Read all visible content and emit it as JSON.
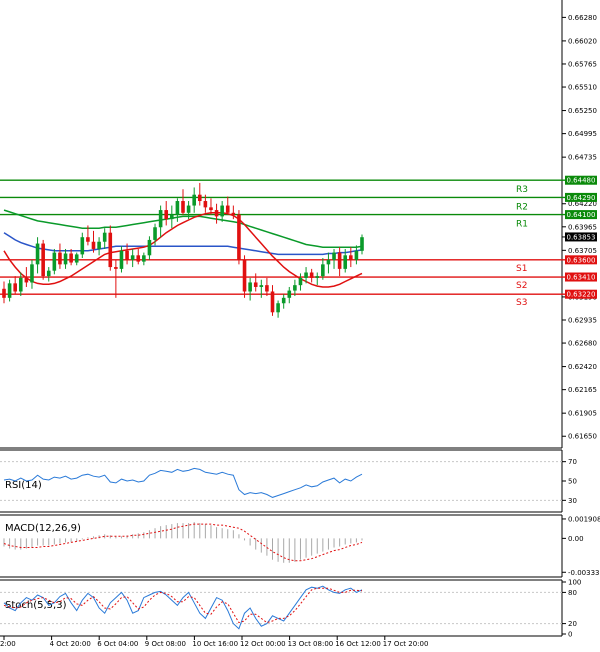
{
  "chart_data": {
    "type": "candlestick",
    "price_axis": {
      "ylim": [
        0.6152,
        0.6645
      ],
      "ticks": [
        "0.66280",
        "0.66020",
        "0.65765",
        "0.65510",
        "0.65250",
        "0.64995",
        "0.64735",
        "0.64220",
        "0.63965",
        "0.63705",
        "0.63190",
        "0.62935",
        "0.62680",
        "0.62420",
        "0.62165",
        "0.61905",
        "0.61650"
      ],
      "current_price": "0.63853"
    },
    "time_axis": {
      "labels": [
        "2:00",
        "4 Oct 20:00",
        "6 Oct 04:00",
        "9 Oct 08:00",
        "10 Oct 16:00",
        "12 Oct 00:00",
        "13 Oct 08:00",
        "16 Oct 12:00",
        "17 Oct 20:00"
      ]
    },
    "resistance": [
      {
        "name": "R3",
        "price": 0.6448,
        "label": "0.64480"
      },
      {
        "name": "R2",
        "price": 0.6429,
        "label": "0.64290"
      },
      {
        "name": "R1",
        "price": 0.641,
        "label": "0.64100"
      }
    ],
    "support": [
      {
        "name": "S1",
        "price": 0.636,
        "label": "0.63600"
      },
      {
        "name": "S2",
        "price": 0.6341,
        "label": "0.63410"
      },
      {
        "name": "S3",
        "price": 0.6322,
        "label": "0.63220"
      }
    ],
    "candles": [
      [
        0.6328,
        0.6336,
        0.6312,
        0.6318
      ],
      [
        0.6318,
        0.6338,
        0.6314,
        0.6334
      ],
      [
        0.6334,
        0.6342,
        0.6322,
        0.6325
      ],
      [
        0.6325,
        0.6346,
        0.632,
        0.634
      ],
      [
        0.634,
        0.6352,
        0.633,
        0.6335
      ],
      [
        0.6335,
        0.636,
        0.6328,
        0.6355
      ],
      [
        0.6355,
        0.6385,
        0.6345,
        0.6378
      ],
      [
        0.6378,
        0.6382,
        0.6338,
        0.6342
      ],
      [
        0.6342,
        0.6352,
        0.6336,
        0.6348
      ],
      [
        0.6348,
        0.6372,
        0.6344,
        0.6368
      ],
      [
        0.6368,
        0.6378,
        0.635,
        0.6355
      ],
      [
        0.6355,
        0.6372,
        0.635,
        0.6367
      ],
      [
        0.6367,
        0.6372,
        0.6354,
        0.6357
      ],
      [
        0.6357,
        0.6368,
        0.6354,
        0.6366
      ],
      [
        0.6366,
        0.639,
        0.6362,
        0.6385
      ],
      [
        0.6385,
        0.6398,
        0.6376,
        0.638
      ],
      [
        0.638,
        0.6392,
        0.6368,
        0.6372
      ],
      [
        0.6372,
        0.6385,
        0.6365,
        0.638
      ],
      [
        0.638,
        0.6395,
        0.6372,
        0.639
      ],
      [
        0.639,
        0.6398,
        0.6348,
        0.6352
      ],
      [
        0.6352,
        0.636,
        0.6318,
        0.635
      ],
      [
        0.635,
        0.6375,
        0.6346,
        0.637
      ],
      [
        0.637,
        0.6378,
        0.6355,
        0.636
      ],
      [
        0.636,
        0.6372,
        0.6352,
        0.6365
      ],
      [
        0.6365,
        0.6372,
        0.6355,
        0.6358
      ],
      [
        0.6358,
        0.6368,
        0.6354,
        0.6365
      ],
      [
        0.6365,
        0.6386,
        0.636,
        0.6382
      ],
      [
        0.6382,
        0.64,
        0.6376,
        0.6396
      ],
      [
        0.6396,
        0.642,
        0.6385,
        0.6415
      ],
      [
        0.6415,
        0.6425,
        0.6398,
        0.6405
      ],
      [
        0.6405,
        0.642,
        0.6395,
        0.641
      ],
      [
        0.641,
        0.6428,
        0.6402,
        0.6425
      ],
      [
        0.6425,
        0.6438,
        0.641,
        0.6412
      ],
      [
        0.6412,
        0.6425,
        0.6405,
        0.642
      ],
      [
        0.642,
        0.644,
        0.6412,
        0.6432
      ],
      [
        0.6432,
        0.6445,
        0.642,
        0.6425
      ],
      [
        0.6425,
        0.6432,
        0.6412,
        0.6418
      ],
      [
        0.6418,
        0.6428,
        0.641,
        0.6415
      ],
      [
        0.6415,
        0.6422,
        0.64,
        0.6408
      ],
      [
        0.6408,
        0.6425,
        0.6402,
        0.642
      ],
      [
        0.642,
        0.643,
        0.641,
        0.6412
      ],
      [
        0.6412,
        0.642,
        0.6405,
        0.641
      ],
      [
        0.641,
        0.6415,
        0.6355,
        0.636
      ],
      [
        0.636,
        0.6365,
        0.6318,
        0.6325
      ],
      [
        0.6325,
        0.634,
        0.6315,
        0.6335
      ],
      [
        0.6335,
        0.6345,
        0.6325,
        0.633
      ],
      [
        0.633,
        0.6338,
        0.6318,
        0.6332
      ],
      [
        0.6332,
        0.634,
        0.632,
        0.6325
      ],
      [
        0.6325,
        0.6332,
        0.6298,
        0.6302
      ],
      [
        0.6302,
        0.6315,
        0.6296,
        0.6312
      ],
      [
        0.6312,
        0.6322,
        0.6306,
        0.6318
      ],
      [
        0.6318,
        0.633,
        0.6312,
        0.6326
      ],
      [
        0.6326,
        0.6338,
        0.632,
        0.6332
      ],
      [
        0.6332,
        0.6345,
        0.6326,
        0.634
      ],
      [
        0.634,
        0.6352,
        0.6334,
        0.6346
      ],
      [
        0.6346,
        0.635,
        0.6335,
        0.634
      ],
      [
        0.634,
        0.6346,
        0.6332,
        0.6342
      ],
      [
        0.6342,
        0.6362,
        0.6338,
        0.6355
      ],
      [
        0.6355,
        0.6368,
        0.6345,
        0.636
      ],
      [
        0.636,
        0.6372,
        0.635,
        0.6368
      ],
      [
        0.6368,
        0.6374,
        0.6342,
        0.635
      ],
      [
        0.635,
        0.6372,
        0.6346,
        0.6365
      ],
      [
        0.6365,
        0.6374,
        0.6352,
        0.636
      ],
      [
        0.636,
        0.6376,
        0.6355,
        0.637
      ],
      [
        0.637,
        0.6388,
        0.6366,
        0.6385
      ]
    ],
    "moving_averages": [
      {
        "color": "#0a9a2a",
        "values": [
          0.6415,
          0.6413,
          0.6411,
          0.6409,
          0.6407,
          0.6405,
          0.6403,
          0.6402,
          0.6401,
          0.64,
          0.6399,
          0.6398,
          0.6397,
          0.6396,
          0.6395,
          0.6395,
          0.6395,
          0.6395,
          0.6396,
          0.6396,
          0.6396,
          0.6397,
          0.6398,
          0.6399,
          0.64,
          0.6401,
          0.6402,
          0.6403,
          0.6404,
          0.6405,
          0.6406,
          0.6407,
          0.6408,
          0.6408,
          0.6408,
          0.6408,
          0.6407,
          0.6406,
          0.6405,
          0.6404,
          0.6403,
          0.6402,
          0.6401,
          0.6399,
          0.6397,
          0.6395,
          0.6393,
          0.6391,
          0.6389,
          0.6387,
          0.6385,
          0.6383,
          0.6381,
          0.6379,
          0.6377,
          0.6376,
          0.6375,
          0.6374,
          0.6374,
          0.6374,
          0.6374,
          0.6374,
          0.6374,
          0.6374,
          0.6375
        ]
      },
      {
        "color": "#2a55c8",
        "values": [
          0.639,
          0.6386,
          0.6382,
          0.6379,
          0.6377,
          0.6375,
          0.6373,
          0.6372,
          0.6371,
          0.637,
          0.637,
          0.637,
          0.637,
          0.637,
          0.637,
          0.637,
          0.6371,
          0.6372,
          0.6373,
          0.6374,
          0.6375,
          0.6375,
          0.6375,
          0.6375,
          0.6375,
          0.6375,
          0.6375,
          0.6375,
          0.6375,
          0.6375,
          0.6375,
          0.6375,
          0.6375,
          0.6375,
          0.6375,
          0.6375,
          0.6375,
          0.6375,
          0.6375,
          0.6375,
          0.6375,
          0.6374,
          0.6373,
          0.6372,
          0.6371,
          0.637,
          0.6369,
          0.6368,
          0.6367,
          0.6366,
          0.6366,
          0.6366,
          0.6366,
          0.6366,
          0.6366,
          0.6366,
          0.6366,
          0.6366,
          0.6367,
          0.6367,
          0.6368,
          0.6368,
          0.6369,
          0.637,
          0.6371
        ]
      },
      {
        "color": "#e01010",
        "values": [
          0.637,
          0.636,
          0.6352,
          0.6345,
          0.634,
          0.6336,
          0.6334,
          0.6333,
          0.6333,
          0.6334,
          0.6336,
          0.6339,
          0.6342,
          0.6346,
          0.635,
          0.6354,
          0.6358,
          0.6362,
          0.6366,
          0.6368,
          0.6369,
          0.637,
          0.6371,
          0.6372,
          0.6373,
          0.6374,
          0.6376,
          0.638,
          0.6385,
          0.639,
          0.6394,
          0.6398,
          0.6401,
          0.6404,
          0.6407,
          0.6409,
          0.6411,
          0.6412,
          0.6412,
          0.6412,
          0.6411,
          0.6409,
          0.6405,
          0.6399,
          0.6392,
          0.6385,
          0.6378,
          0.6371,
          0.6364,
          0.6358,
          0.6352,
          0.6347,
          0.6343,
          0.6339,
          0.6336,
          0.6333,
          0.6331,
          0.633,
          0.633,
          0.6331,
          0.6333,
          0.6336,
          0.6339,
          0.6342,
          0.6345
        ]
      }
    ],
    "rsi": {
      "title": "RSI(14)",
      "ylim": [
        20,
        80
      ],
      "ticks": [
        "70",
        "50",
        "30"
      ],
      "values": [
        51,
        52,
        50,
        53,
        50,
        51,
        56,
        52,
        51,
        54,
        53,
        55,
        52,
        53,
        56,
        57,
        55,
        54,
        56,
        49,
        48,
        52,
        50,
        51,
        49,
        50,
        56,
        58,
        61,
        60,
        59,
        62,
        60,
        61,
        63,
        62,
        59,
        58,
        57,
        59,
        57,
        56,
        41,
        36,
        38,
        37,
        38,
        36,
        33,
        35,
        37,
        39,
        41,
        43,
        46,
        44,
        45,
        49,
        51,
        53,
        48,
        52,
        50,
        54,
        57
      ]
    },
    "macd": {
      "title": "MACD(12,26,9)",
      "ylim": [
        -0.0036,
        0.0021
      ],
      "ticks": [
        "0.001908",
        "0.00",
        "-0.003331"
      ],
      "hist": [
        -0.0008,
        -0.001,
        -0.0011,
        -0.0011,
        -0.001,
        -0.0009,
        -0.0007,
        -0.0007,
        -0.0007,
        -0.0006,
        -0.0005,
        -0.0004,
        -0.0004,
        -0.0003,
        -0.0001,
        0.0001,
        0.0002,
        0.0003,
        0.0004,
        0.0003,
        0.0002,
        0.0002,
        0.0003,
        0.0004,
        0.0005,
        0.0006,
        0.0008,
        0.001,
        0.0012,
        0.0013,
        0.0014,
        0.0015,
        0.0015,
        0.0015,
        0.0016,
        0.0015,
        0.0014,
        0.0013,
        0.0011,
        0.001,
        0.0009,
        0.0008,
        0.0004,
        -0.0002,
        -0.0007,
        -0.0011,
        -0.0014,
        -0.0017,
        -0.0021,
        -0.0023,
        -0.0024,
        -0.0024,
        -0.0023,
        -0.0021,
        -0.0019,
        -0.0017,
        -0.0015,
        -0.0013,
        -0.0011,
        -0.0009,
        -0.0008,
        -0.0006,
        -0.0005,
        -0.0004,
        -0.0002
      ],
      "signal": [
        -0.0005,
        -0.0007,
        -0.0008,
        -0.0009,
        -0.0009,
        -0.0009,
        -0.0009,
        -0.0008,
        -0.0008,
        -0.0007,
        -0.0006,
        -0.0005,
        -0.0004,
        -0.0003,
        -0.0002,
        -0.0001,
        0.0,
        0.0001,
        0.0002,
        0.0002,
        0.0002,
        0.0002,
        0.0002,
        0.0003,
        0.0003,
        0.0004,
        0.0005,
        0.0006,
        0.0007,
        0.0008,
        0.0009,
        0.0011,
        0.0012,
        0.0013,
        0.0014,
        0.0014,
        0.0014,
        0.0014,
        0.0013,
        0.0013,
        0.0012,
        0.0011,
        0.001,
        0.0007,
        0.0003,
        -0.0001,
        -0.0005,
        -0.0009,
        -0.0013,
        -0.0016,
        -0.0019,
        -0.0021,
        -0.0022,
        -0.0022,
        -0.0021,
        -0.002,
        -0.0018,
        -0.0016,
        -0.0014,
        -0.0012,
        -0.0011,
        -0.0009,
        -0.0007,
        -0.0006,
        -0.0004
      ]
    },
    "stoch": {
      "title": "Stoch(5,5,3)",
      "ylim": [
        0,
        100
      ],
      "ticks": [
        "100",
        "80",
        "20",
        "0"
      ],
      "k": [
        60,
        50,
        45,
        60,
        70,
        65,
        75,
        70,
        55,
        60,
        72,
        78,
        60,
        45,
        65,
        78,
        70,
        50,
        40,
        60,
        70,
        80,
        65,
        40,
        45,
        70,
        75,
        80,
        82,
        75,
        65,
        55,
        70,
        80,
        60,
        40,
        30,
        50,
        70,
        65,
        45,
        20,
        10,
        40,
        50,
        30,
        15,
        20,
        35,
        30,
        25,
        40,
        55,
        70,
        85,
        90,
        88,
        92,
        85,
        80,
        78,
        85,
        88,
        80,
        85
      ],
      "d": [
        55,
        52,
        50,
        52,
        60,
        65,
        68,
        70,
        65,
        60,
        62,
        70,
        68,
        58,
        55,
        65,
        72,
        62,
        50,
        48,
        58,
        70,
        72,
        60,
        48,
        52,
        65,
        75,
        80,
        78,
        72,
        62,
        62,
        72,
        70,
        55,
        40,
        38,
        52,
        62,
        58,
        40,
        22,
        25,
        38,
        38,
        30,
        22,
        25,
        30,
        30,
        35,
        45,
        58,
        72,
        85,
        88,
        88,
        88,
        84,
        80,
        80,
        84,
        84,
        83
      ]
    }
  }
}
